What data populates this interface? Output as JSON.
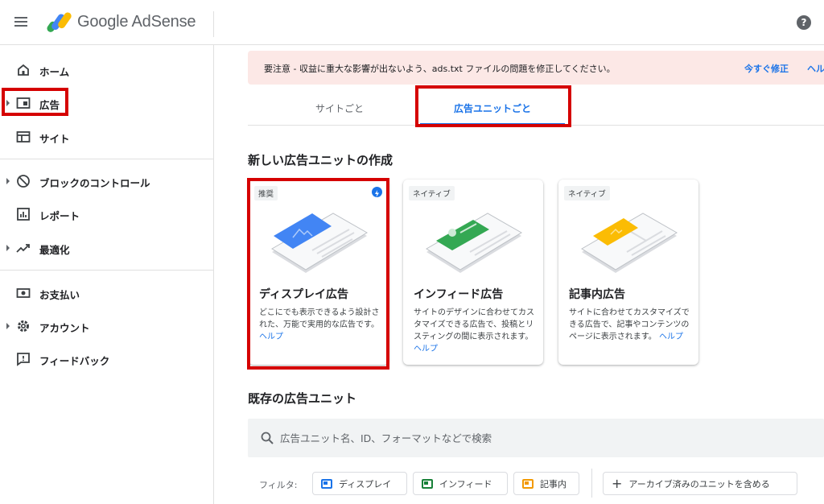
{
  "header": {
    "brand": "Google AdSense",
    "help": "?"
  },
  "sidebar": {
    "items": [
      {
        "label": "ホーム",
        "icon": "home-icon"
      },
      {
        "label": "広告",
        "icon": "ad-icon"
      },
      {
        "label": "サイト",
        "icon": "site-icon"
      },
      {
        "label": "ブロックのコントロール",
        "icon": "block-icon"
      },
      {
        "label": "レポート",
        "icon": "report-icon"
      },
      {
        "label": "最適化",
        "icon": "trend-icon"
      },
      {
        "label": "お支払い",
        "icon": "payment-icon"
      },
      {
        "label": "アカウント",
        "icon": "gear-icon"
      },
      {
        "label": "フィードバック",
        "icon": "feedback-icon"
      }
    ]
  },
  "alert": {
    "text": "要注意 - 収益に重大な影響が出ないよう、ads.txt ファイルの問題を修正してください。",
    "fix_label": "今すぐ修正",
    "help_label": "ヘル"
  },
  "tabs": [
    {
      "label": "サイトごと"
    },
    {
      "label": "広告ユニットごと"
    }
  ],
  "new_section": {
    "title": "新しい広告ユニットの作成",
    "cards": [
      {
        "badge": "推奨",
        "title": "ディスプレイ広告",
        "desc": "どこにでも表示できるよう設計された、万能で実用的な広告です。",
        "link": "ヘルプ"
      },
      {
        "badge": "ネイティブ",
        "title": "インフィード広告",
        "desc": "サイトのデザインに合わせてカスタマイズできる広告で、投稿とリスティングの間に表示されます。",
        "link": "ヘルプ"
      },
      {
        "badge": "ネイティブ",
        "title": "記事内広告",
        "desc": "サイトに合わせてカスタマイズできる広告で、記事やコンテンツのページに表示されます。",
        "link": "ヘルプ"
      }
    ]
  },
  "existing_section": {
    "title": "既存の広告ユニット",
    "search_placeholder": "広告ユニット名、ID、フォーマットなどで検索",
    "filter_label": "フィルタ:",
    "chips": [
      "ディスプレイ",
      "インフィード",
      "記事内"
    ],
    "archive_label": "アーカイブ済みのユニットを含める"
  },
  "colors": {
    "accent": "#1a73e8",
    "highlight": "#d50000",
    "alert_bg": "#fce8e6"
  }
}
